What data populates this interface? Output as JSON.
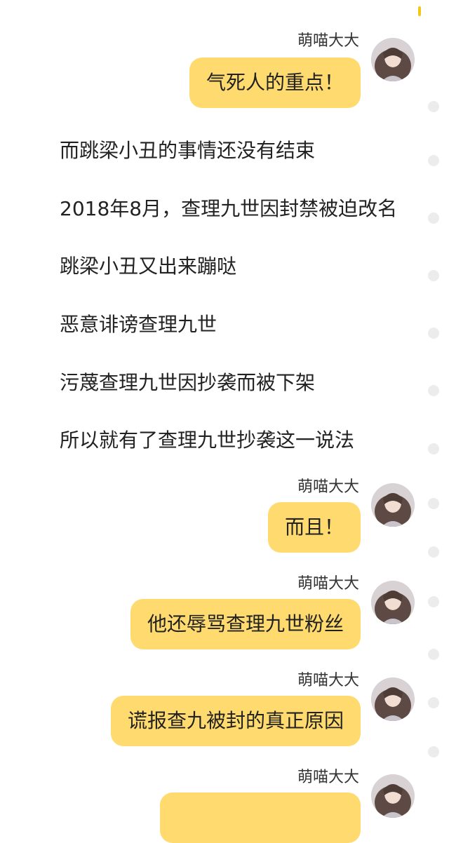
{
  "accent_color": "#f5c518",
  "bubble_color": "#ffdb6f",
  "messages": [
    {
      "sender": "萌喵大大",
      "text": "气死人的重点！"
    },
    {
      "sender": "萌喵大大",
      "text": "而且！"
    },
    {
      "sender": "萌喵大大",
      "text": "他还辱骂查理九世粉丝"
    },
    {
      "sender": "萌喵大大",
      "text": "谎报查九被封的真正原因"
    },
    {
      "sender": "萌喵大大",
      "text": ""
    }
  ],
  "narration": [
    "而跳梁小丑的事情还没有结束",
    "2018年8月，查理九世因封禁被迫改名",
    "跳梁小丑又出来蹦哒",
    "恶意诽谤查理九世",
    "污蔑查理九世因抄袭而被下架",
    "所以就有了查理九世抄袭这一说法"
  ]
}
